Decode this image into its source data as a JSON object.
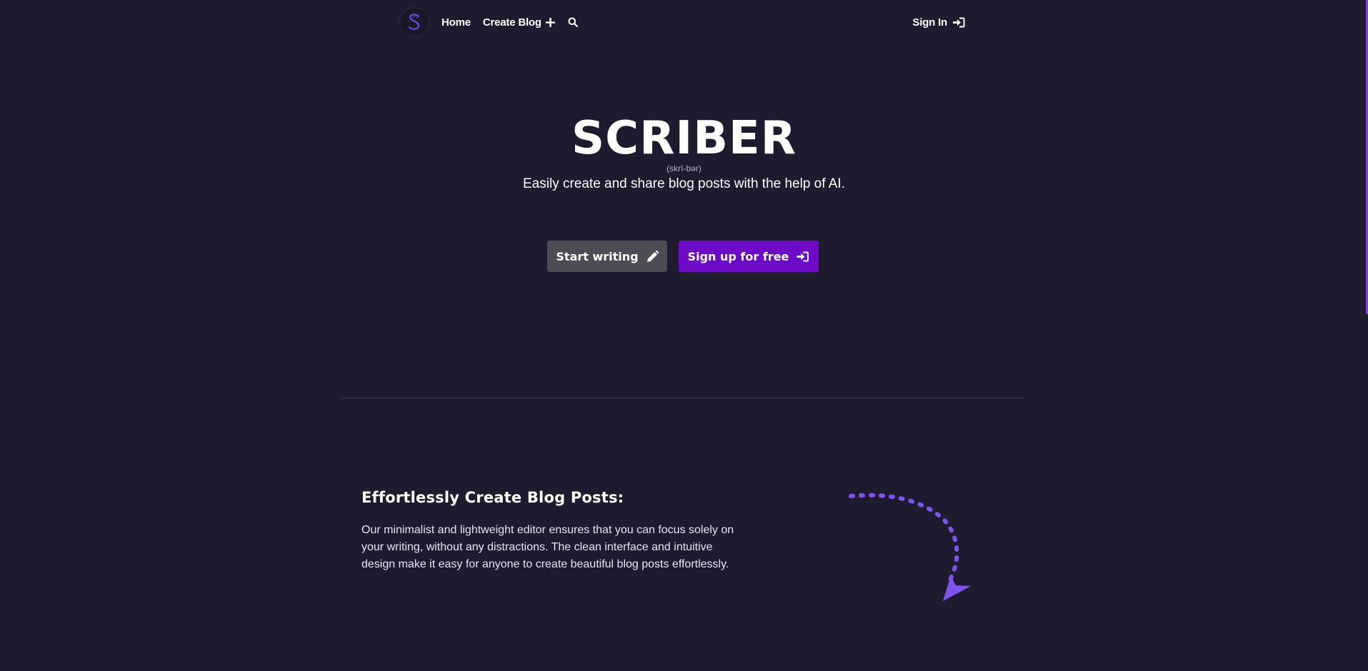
{
  "nav": {
    "logo_letter": "S",
    "home_label": "Home",
    "create_label": "Create Blog",
    "signin_label": "Sign In"
  },
  "hero": {
    "title": "SCRIBER",
    "phonetic": "(skrī-bər)",
    "subtitle": "Easily create and share blog posts with the help of AI.",
    "start_button": "Start writing",
    "signup_button": "Sign up for free"
  },
  "feature": {
    "heading": "Effortlessly Create Blog Posts:",
    "body": "Our minimalist and lightweight editor ensures that you can focus solely on your writing, without any distractions. The clean interface and intuitive design make it easy for anyone to create beautiful blog posts effortlessly."
  },
  "colors": {
    "background": "#1f1b2e",
    "accent_purple": "#6d0bc9",
    "arrow_purple": "#7c55f0",
    "button_gray": "#4d4b53"
  },
  "icons": {
    "create": "plus-icon",
    "search": "search-icon",
    "signin": "sign-in-icon",
    "start": "pencil-icon",
    "signup": "sign-in-icon",
    "decoration": "dashed-curved-arrow-icon"
  }
}
